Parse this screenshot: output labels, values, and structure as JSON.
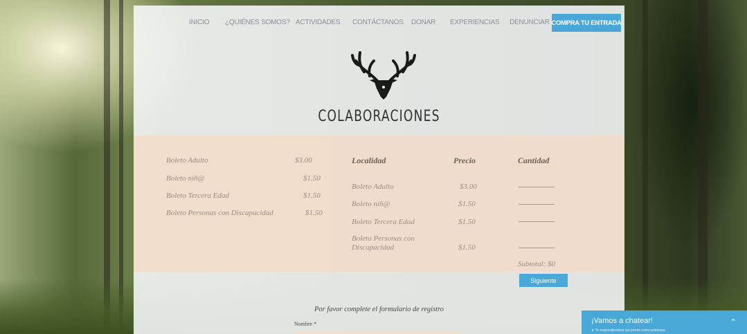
{
  "nav": {
    "items": [
      "INICIO",
      "¿QUIÉNES SOMOS?",
      "ACTIVIDADES",
      "CONTÁCTANOS",
      "DONAR",
      "EXPERIENCIAS",
      "DENUNCIAR"
    ],
    "cta": "COMPRA TU ENTRADA"
  },
  "page_title": "Colaboraciones",
  "price_list": [
    {
      "name": "Boleto Adulto",
      "price": "$3.00"
    },
    {
      "name": "Boleto niñ@",
      "price": "$1.50"
    },
    {
      "name": "Boleto Tercera Edad",
      "price": "$1.50"
    },
    {
      "name": "Boleto Personas con Discapacidad",
      "price": "$1.50"
    }
  ],
  "table": {
    "headers": {
      "location": "Localidad",
      "price": "Precio",
      "quantity": "Cantidad"
    },
    "rows": [
      {
        "name": "Boleto Adulto",
        "price": "$3.00"
      },
      {
        "name": "Boleto niñ@",
        "price": "$1.50"
      },
      {
        "name": "Boleto Tercera Edad",
        "price": "$1.50"
      },
      {
        "name_line1": "Boleto Personas con",
        "name_line2": "Discapacidad",
        "price": "$1.50"
      }
    ],
    "subtotal": "Subtotal: $0",
    "next_button": "Siguiente"
  },
  "form": {
    "note": "Por favor complete el formulario de registro",
    "name_label": "Nombre *"
  },
  "chat": {
    "title": "¡Vamos a chatear!",
    "subtitle": "★  Te responderemos tan pronto como podamos",
    "chevron": "⌃"
  },
  "colors": {
    "accent": "#4aa8d8",
    "peach": "#f2dbc8"
  }
}
